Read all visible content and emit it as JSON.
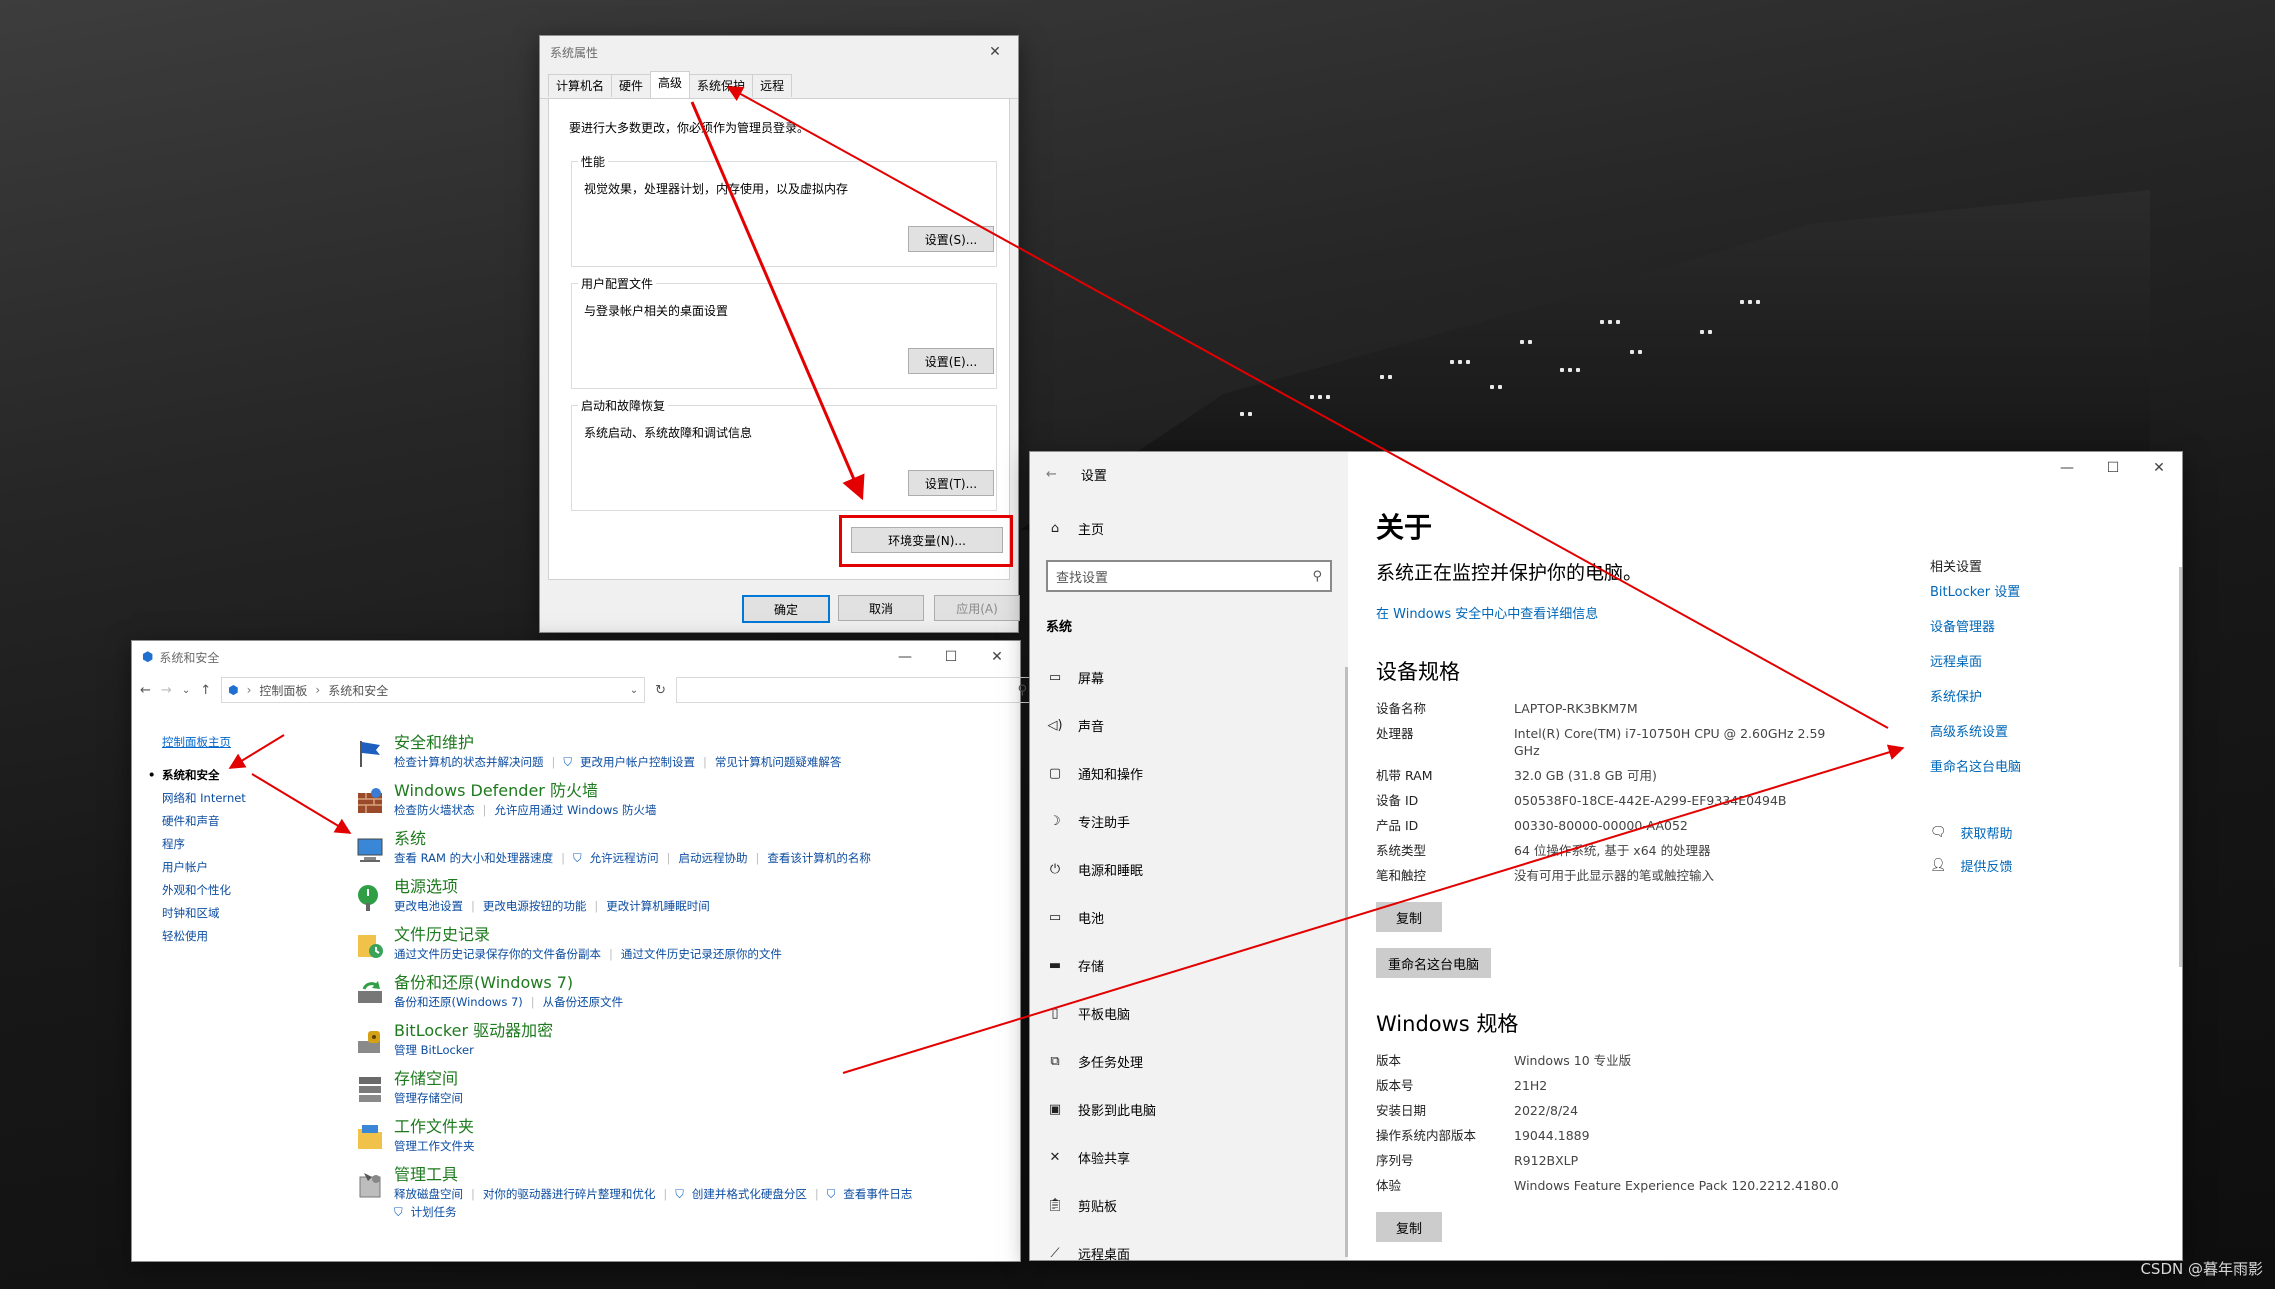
{
  "system_properties": {
    "title": "系统属性",
    "tabs": [
      "计算机名",
      "硬件",
      "高级",
      "系统保护",
      "远程"
    ],
    "note": "要进行大多数更改，你必须作为管理员登录。",
    "groups": [
      {
        "title": "性能",
        "text": "视觉效果，处理器计划，内存使用，以及虚拟内存",
        "button": "设置(S)..."
      },
      {
        "title": "用户配置文件",
        "text": "与登录帐户相关的桌面设置",
        "button": "设置(E)..."
      },
      {
        "title": "启动和故障恢复",
        "text": "系统启动、系统故障和调试信息",
        "button": "设置(T)..."
      }
    ],
    "env_button": "环境变量(N)...",
    "ok": "确定",
    "cancel": "取消",
    "apply": "应用(A)"
  },
  "control_panel": {
    "title": "系统和安全",
    "breadcrumb": [
      "控制面板",
      "系统和安全"
    ],
    "sidebar": {
      "home": "控制面板主页",
      "items": [
        "系统和安全",
        "网络和 Internet",
        "硬件和声音",
        "程序",
        "用户帐户",
        "外观和个性化",
        "时钟和区域",
        "轻松使用"
      ]
    },
    "categories": [
      {
        "title": "安全和维护",
        "links": [
          "检查计算机的状态并解决问题",
          "更改用户帐户控制设置",
          "常见计算机问题疑难解答"
        ]
      },
      {
        "title": "Windows Defender 防火墙",
        "links": [
          "检查防火墙状态",
          "允许应用通过 Windows 防火墙"
        ]
      },
      {
        "title": "系统",
        "links": [
          "查看 RAM 的大小和处理器速度",
          "允许远程访问",
          "启动远程协助",
          "查看该计算机的名称"
        ]
      },
      {
        "title": "电源选项",
        "links": [
          "更改电池设置",
          "更改电源按钮的功能",
          "更改计算机睡眠时间"
        ]
      },
      {
        "title": "文件历史记录",
        "links": [
          "通过文件历史记录保存你的文件备份副本",
          "通过文件历史记录还原你的文件"
        ]
      },
      {
        "title": "备份和还原(Windows 7)",
        "links": [
          "备份和还原(Windows 7)",
          "从备份还原文件"
        ]
      },
      {
        "title": "BitLocker 驱动器加密",
        "links": [
          "管理 BitLocker"
        ]
      },
      {
        "title": "存储空间",
        "links": [
          "管理存储空间"
        ]
      },
      {
        "title": "工作文件夹",
        "links": [
          "管理工作文件夹"
        ]
      },
      {
        "title": "管理工具",
        "links": [
          "释放磁盘空间",
          "对你的驱动器进行碎片整理和优化",
          "创建并格式化硬盘分区",
          "查看事件日志",
          "计划任务"
        ]
      }
    ]
  },
  "settings": {
    "title": "设置",
    "home": "主页",
    "search_placeholder": "查找设置",
    "section": "系统",
    "nav": [
      "屏幕",
      "声音",
      "通知和操作",
      "专注助手",
      "电源和睡眠",
      "电池",
      "存储",
      "平板电脑",
      "多任务处理",
      "投影到此电脑",
      "体验共享",
      "剪贴板",
      "远程桌面"
    ],
    "heading": "关于",
    "status": "系统正在监控并保护你的电脑。",
    "security_link": "在 Windows 安全中心中查看详细信息",
    "device_spec_title": "设备规格",
    "device_specs": [
      {
        "label": "设备名称",
        "value": "LAPTOP-RK3BKM7M"
      },
      {
        "label": "处理器",
        "value": "Intel(R) Core(TM) i7-10750H CPU @ 2.60GHz   2.59 GHz"
      },
      {
        "label": "机带 RAM",
        "value": "32.0 GB (31.8 GB 可用)"
      },
      {
        "label": "设备 ID",
        "value": "050538F0-18CE-442E-A299-EF9334E0494B"
      },
      {
        "label": "产品 ID",
        "value": "00330-80000-00000-AA052"
      },
      {
        "label": "系统类型",
        "value": "64 位操作系统, 基于 x64 的处理器"
      },
      {
        "label": "笔和触控",
        "value": "没有可用于此显示器的笔或触控输入"
      }
    ],
    "copy": "复制",
    "rename": "重命名这台电脑",
    "win_spec_title": "Windows 规格",
    "win_specs": [
      {
        "label": "版本",
        "value": "Windows 10 专业版"
      },
      {
        "label": "版本号",
        "value": "21H2"
      },
      {
        "label": "安装日期",
        "value": "2022/8/24"
      },
      {
        "label": "操作系统内部版本",
        "value": "19044.1889"
      },
      {
        "label": "序列号",
        "value": "R912BXLP"
      },
      {
        "label": "体验",
        "value": "Windows Feature Experience Pack 120.2212.4180.0"
      }
    ],
    "related_title": "相关设置",
    "related": [
      "BitLocker 设置",
      "设备管理器",
      "远程桌面",
      "系统保护",
      "高级系统设置",
      "重命名这台电脑"
    ],
    "help": "获取帮助",
    "feedback": "提供反馈"
  },
  "watermark": "CSDN @暮年雨影",
  "colors": {
    "accent": "#0067b8",
    "annotation": "#e30000",
    "cp_title": "#1e7a1e"
  }
}
